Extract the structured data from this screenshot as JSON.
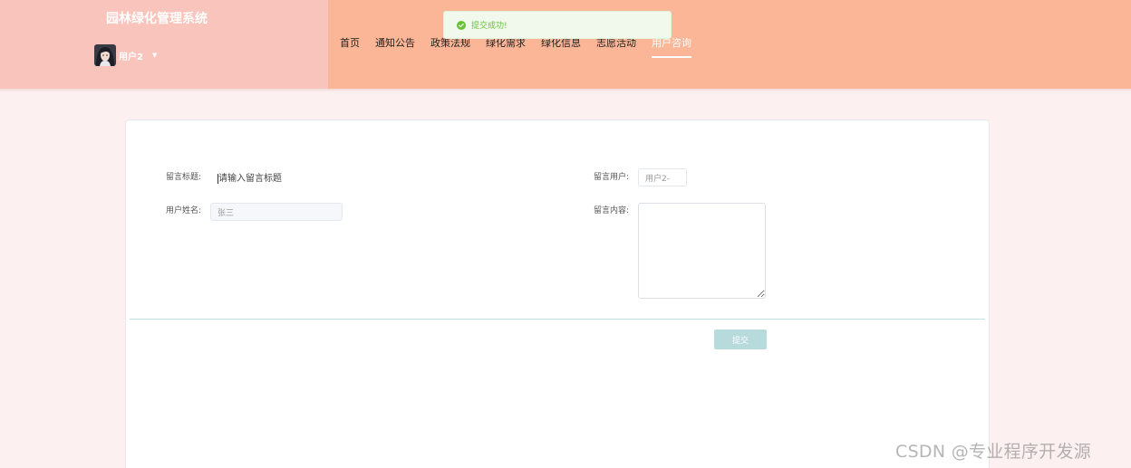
{
  "header": {
    "site_title": "园林绿化管理系统",
    "user": {
      "name": "用户2",
      "avatar_icon": "avatar-photo"
    },
    "nav": [
      {
        "label": "首页",
        "active": false
      },
      {
        "label": "通知公告",
        "active": false
      },
      {
        "label": "政策法规",
        "active": false
      },
      {
        "label": "绿化需求",
        "active": false
      },
      {
        "label": "绿化信息",
        "active": false
      },
      {
        "label": "志愿活动",
        "active": false
      },
      {
        "label": "用户咨询",
        "active": true
      }
    ]
  },
  "toast": {
    "icon": "check-circle-icon",
    "message": "提交成功!",
    "color": "#67c23a"
  },
  "form": {
    "title_label": "留言标题:",
    "title_placeholder": "请输入留言标题",
    "user_label": "留言用户:",
    "user_value": "用户2-",
    "name_label": "用户姓名:",
    "name_value": "张三",
    "content_label": "留言内容:",
    "content_value": "",
    "submit_label": "提交"
  },
  "watermark": "CSDN @专业程序开发源",
  "colors": {
    "brand_panel": "#f9c4bb",
    "nav_panel": "#fbb597",
    "page_background": "#fdf0f0",
    "submit_button": "#b7dadd"
  }
}
